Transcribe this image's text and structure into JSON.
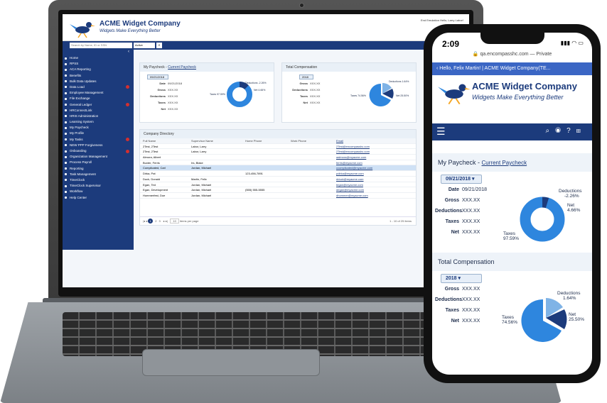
{
  "brand": {
    "name": "ACME Widget Company",
    "tagline": "Widgets Make Everything Better"
  },
  "desktop": {
    "top_links": "End Emulation  Hello, Larry Labor!",
    "search": {
      "placeholder": "Search by Name, ID or SSN",
      "scope": "Active"
    },
    "sidebar": [
      {
        "label": "Home"
      },
      {
        "label": "RPSS"
      },
      {
        "label": "ACA Reporting"
      },
      {
        "label": "Benefits"
      },
      {
        "label": "Bulk Data Updates"
      },
      {
        "label": "Data Load",
        "badge": true
      },
      {
        "label": "Employee Management"
      },
      {
        "label": "File Exchange"
      },
      {
        "label": "General Ledger",
        "badge": true
      },
      {
        "label": "HRConnectLink"
      },
      {
        "label": "HRIS Administration"
      },
      {
        "label": "Learning System"
      },
      {
        "label": "My Paycheck"
      },
      {
        "label": "My Profile"
      },
      {
        "label": "My Tasks",
        "badge": true
      },
      {
        "label": "NEW PPP Forgiveness"
      },
      {
        "label": "Onboarding",
        "badge": true
      },
      {
        "label": "Organization Management"
      },
      {
        "label": "Process Payroll"
      },
      {
        "label": "Reporting"
      },
      {
        "label": "Task Management"
      },
      {
        "label": "TimeClock"
      },
      {
        "label": "TimeClock Supervisor"
      },
      {
        "label": "Workflow"
      },
      {
        "label": "Help Center"
      }
    ],
    "paycheck": {
      "title": "My Paycheck - ",
      "link": "Current Paycheck",
      "date_select": "09/21/2018",
      "rows": [
        [
          "Date",
          "09/21/2018"
        ],
        [
          "Gross",
          "XXX.XX"
        ],
        [
          "Deductions",
          "XXX.XX"
        ],
        [
          "Taxes",
          "XXX.XX"
        ],
        [
          "Net",
          "XXX.XX"
        ]
      ],
      "labels": {
        "deductions": "Deductions -2.26%",
        "net": "Net 4.66%",
        "taxes": "Taxes 97.59%"
      }
    },
    "compensation": {
      "title": "Total Compensation",
      "year_select": "2018",
      "rows": [
        [
          "Gross",
          "XXX.XX"
        ],
        [
          "Deductions",
          "XXX.XX"
        ],
        [
          "Taxes",
          "XXX.XX"
        ],
        [
          "Net",
          "XXX.XX"
        ]
      ],
      "labels": {
        "deductions": "Deductions 1.64%",
        "net": "Net 25.50%",
        "taxes": "Taxes 74.56%"
      }
    },
    "directory": {
      "title": "Company Directory",
      "columns": [
        "Full Name",
        "Supervisor Name",
        "Home Phone",
        "Work Phone",
        "Email"
      ],
      "rows": [
        [
          "2Test, 2Test",
          "Labor, Larry",
          "",
          "",
          "2Test@encompasshc.com"
        ],
        [
          "2Test, 2Test",
          "Labor, Larry",
          "",
          "",
          "2Test@encompasshc.com"
        ],
        [
          "Almora, Albert",
          "",
          "",
          "",
          "aalmora@myacme.com"
        ],
        [
          "Buxter, Ferris",
          "Irs, Blake",
          "",
          "",
          "ferris@myacme.com"
        ],
        [
          "Complicated, Carl",
          "Jordan, Michael",
          "",
          "",
          "ccomplicated@myacme.com"
        ],
        [
          "Dirka, Pat",
          "",
          "123-456-7891",
          "",
          "pdirka@myacme.com"
        ],
        [
          "Duck, Donald",
          "Martin, Felix",
          "",
          "",
          "dduck@myacme.com"
        ],
        [
          "Egan, Ted",
          "Jordan, Michael",
          "",
          "",
          "tegan@myacme.com"
        ],
        [
          "Egan, Development",
          "Jordan, Michael",
          "(555) 555-5555",
          "",
          "degan@myacme.com"
        ],
        [
          "Hommerfest, Doe",
          "Jordan, Michael",
          "",
          "",
          "dhommer@myacme.com"
        ]
      ],
      "selected_row": 4,
      "pager": {
        "pages": [
          "1",
          "2",
          "3"
        ],
        "current": "1",
        "page_size": "10",
        "page_size_label": "items per page",
        "summary": "1 - 10 of 25 items"
      }
    }
  },
  "phone": {
    "time": "2:09",
    "url": "qa.encompasshc.com — Private",
    "topbar": "Hello, Felix Martin! | ACME Widget Company(TE...",
    "paycheck": {
      "title": "My Paycheck - ",
      "link": "Current Paycheck",
      "date_select": "09/21/2018",
      "rows": [
        [
          "Date",
          "09/21/2018"
        ],
        [
          "Gross",
          "XXX.XX"
        ],
        [
          "Deductions",
          "XXX.XX"
        ],
        [
          "Taxes",
          "XXX.XX"
        ],
        [
          "Net",
          "XXX.XX"
        ]
      ],
      "deductions_label": "Deductions",
      "deductions_value": "-2.26%",
      "net_label": "Net",
      "net_value": "4.66%",
      "taxes_label": "Taxes",
      "taxes_value": "97.59%"
    },
    "compensation": {
      "title": "Total Compensation",
      "year_select": "2018",
      "rows": [
        [
          "Gross",
          "XXX.XX"
        ],
        [
          "Deductions",
          "XXX.XX"
        ],
        [
          "Taxes",
          "XXX.XX"
        ],
        [
          "Net",
          "XXX.XX"
        ]
      ],
      "deductions_label": "Deductions",
      "deductions_value": "1.64%",
      "net_label": "Net",
      "net_value": "25.50%",
      "taxes_label": "Taxes",
      "taxes_value": "74.56%"
    }
  },
  "colors": {
    "brand_navy": "#1c3b7c",
    "chart_blue": "#2e86de",
    "chart_dark": "#1c3b7c",
    "chart_light": "#dce9f5"
  }
}
